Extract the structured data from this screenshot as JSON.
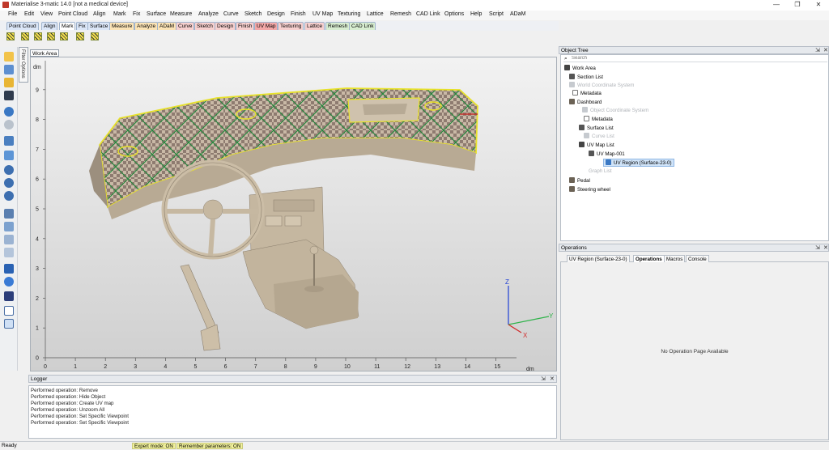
{
  "window": {
    "title": "Materialise 3-matic 14.0 [not a medical device]",
    "minimize": "—",
    "maximize": "❐",
    "close": "✕"
  },
  "menu": [
    "File",
    "Edit",
    "View",
    "Point Cloud",
    "Align",
    "Mark",
    "Fix",
    "Surface",
    "Measure",
    "Analyze",
    "Curve",
    "Sketch",
    "Design",
    "Finish",
    "UV Map",
    "Texturing",
    "Lattice",
    "Remesh",
    "CAD Link",
    "Options",
    "Help",
    "Script",
    "ADaM"
  ],
  "toolbar_tabs": [
    {
      "label": "Point Cloud",
      "color": "#dbe6f7"
    },
    {
      "label": "Align",
      "color": "#dbe6f7"
    },
    {
      "label": "Mark",
      "color": "#ffffff"
    },
    {
      "label": "Fix",
      "color": "#dbe6f7"
    },
    {
      "label": "Surface",
      "color": "#dbe6f7"
    },
    {
      "label": "Measure",
      "color": "#fbe3b5"
    },
    {
      "label": "Analyze",
      "color": "#fbe3b5"
    },
    {
      "label": "ADaM",
      "color": "#fbe3b5"
    },
    {
      "label": "Curve",
      "color": "#f7d0cf"
    },
    {
      "label": "Sketch",
      "color": "#f7d0cf"
    },
    {
      "label": "Design",
      "color": "#f7d0cf"
    },
    {
      "label": "Finish",
      "color": "#f7d0cf"
    },
    {
      "label": "UV Map",
      "color": "#f3a8a8"
    },
    {
      "label": "Texturing",
      "color": "#f7d0cf"
    },
    {
      "label": "Lattice",
      "color": "#f7d0cf"
    },
    {
      "label": "Remesh",
      "color": "#d7edd0"
    },
    {
      "label": "CAD Link",
      "color": "#d7edd0"
    }
  ],
  "left_toolbar_icons": [
    "open-file-icon",
    "save-icon",
    "folder-icon",
    "save-project-icon",
    "undo-icon",
    "redo-icon",
    "navigate-icon",
    "rotate-icon",
    "zoom-in-icon",
    "zoom-window-icon",
    "zoom-out-icon",
    "view-front-icon",
    "view-iso-icon",
    "view-top-icon",
    "view-side-icon",
    "shaded-cube-icon",
    "sphere-icon",
    "render-mode-icon",
    "axis-icon",
    "grid-toggle-icon"
  ],
  "filter_options_label": "Filter Options",
  "work_area": {
    "tab_label": "Work Area",
    "axis_unit_y": "dm",
    "axis_unit_x": "dm",
    "y_ticks": [
      "0",
      "1",
      "2",
      "3",
      "4",
      "5",
      "6",
      "7",
      "8",
      "9"
    ],
    "x_ticks": [
      "0",
      "1",
      "2",
      "3",
      "4",
      "5",
      "6",
      "7",
      "8",
      "9",
      "10",
      "11",
      "12",
      "13",
      "14",
      "15"
    ],
    "triad": {
      "z": "Z",
      "y": "Y",
      "x": "X"
    }
  },
  "logger": {
    "title": "Logger",
    "lines": [
      "Performed operation: Remove",
      "Performed operation: Hide Object",
      "Performed operation: Create UV map",
      "Performed operation: Unzoom All",
      "Performed operation: Set Specific Viewpoint",
      "Performed operation: Set Specific Viewpoint"
    ]
  },
  "object_tree": {
    "title": "Object Tree",
    "search_placeholder": "Search",
    "rows": [
      {
        "label": "Work Area",
        "depth": 0,
        "dim": false
      },
      {
        "label": "Section List",
        "depth": 1,
        "dim": false
      },
      {
        "label": "World Coordinate System",
        "depth": 1,
        "dim": true
      },
      {
        "label": "Metadata",
        "depth": 1,
        "dim": false
      },
      {
        "label": "Dashboard",
        "depth": 1,
        "dim": false
      },
      {
        "label": "Object Coordinate System",
        "depth": 2,
        "dim": true
      },
      {
        "label": "Metadata",
        "depth": 2,
        "dim": false
      },
      {
        "label": "Surface List",
        "depth": 2,
        "dim": false
      },
      {
        "label": "Curve List",
        "depth": 2,
        "dim": true
      },
      {
        "label": "UV Map List",
        "depth": 2,
        "dim": false
      },
      {
        "label": "UV Map-001",
        "depth": 3,
        "dim": false
      },
      {
        "label": "UV Region (Surface-23-0)",
        "depth": 4,
        "dim": false,
        "selected": true
      },
      {
        "label": "Graph List",
        "depth": 2,
        "dim": true
      },
      {
        "label": "Pedal",
        "depth": 1,
        "dim": false
      },
      {
        "label": "Steering wheel",
        "depth": 1,
        "dim": false
      }
    ]
  },
  "operations": {
    "title": "Operations",
    "tabs": [
      "UV Region (Surface-23-0)",
      "Operations",
      "Macros",
      "Console"
    ],
    "active_tab": "Operations",
    "empty_message": "No Operation Page Available"
  },
  "status": {
    "ready": "Ready",
    "expert_mode": "Expert mode: ON",
    "remember_params": "Remember parameters: ON"
  },
  "panel_buttons": {
    "pin": "⇲",
    "close": "✕"
  }
}
